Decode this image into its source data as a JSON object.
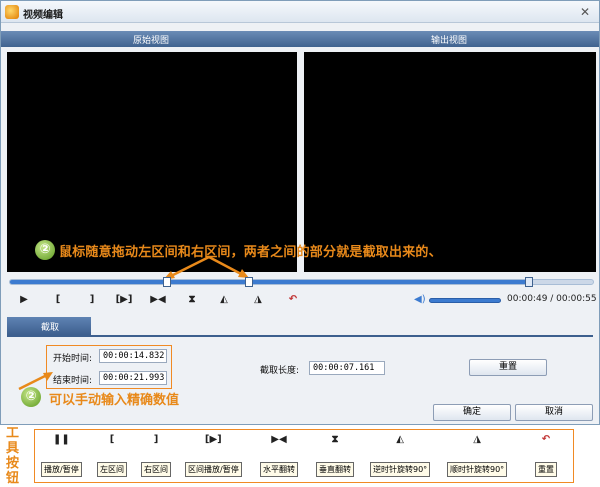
{
  "window": {
    "title": "视频编辑"
  },
  "views": {
    "original": "原始视图",
    "output": "输出视图"
  },
  "annotations": {
    "step_badge": "②",
    "drag_hint": "鼠标随意拖动左区间和右区间，两者之间的部分就是截取出来的、",
    "manual_hint": "可以手动输入精确数值",
    "tools_label": "工具按钮"
  },
  "playback": {
    "progress": 0.89,
    "left_marker": 0.27,
    "right_marker": 0.41,
    "time_readout": "00:00:49 / 00:00:55",
    "volume": 1.0
  },
  "tabs": [
    {
      "label": "截取"
    }
  ],
  "clip": {
    "start_label": "开始时间:",
    "start_value": "00:00:14.832",
    "end_label": "结束时间:",
    "end_value": "00:00:21.993",
    "length_label": "截取长度:",
    "length_value": "00:00:07.161",
    "reset_label": "重置"
  },
  "footer": {
    "ok_label": "确定",
    "cancel_label": "取消"
  },
  "tools": [
    {
      "icon": "play-pause-icon",
      "label": "播放/暂停"
    },
    {
      "icon": "left-bracket-icon",
      "label": "左区间"
    },
    {
      "icon": "right-bracket-icon",
      "label": "右区间"
    },
    {
      "icon": "interval-play-icon",
      "label": "区间播放/暂停"
    },
    {
      "icon": "flip-horizontal-icon",
      "label": "水平翻转"
    },
    {
      "icon": "flip-vertical-icon",
      "label": "垂直翻转"
    },
    {
      "icon": "rotate-ccw-icon",
      "label": "逆时针旋转90°"
    },
    {
      "icon": "rotate-cw-icon",
      "label": "顺时针旋转90°"
    },
    {
      "icon": "reset-icon",
      "label": "重置"
    }
  ],
  "colors": {
    "accent": "#3c7bd0",
    "annotation": "#e8891a",
    "header": "#4a6d9c"
  }
}
